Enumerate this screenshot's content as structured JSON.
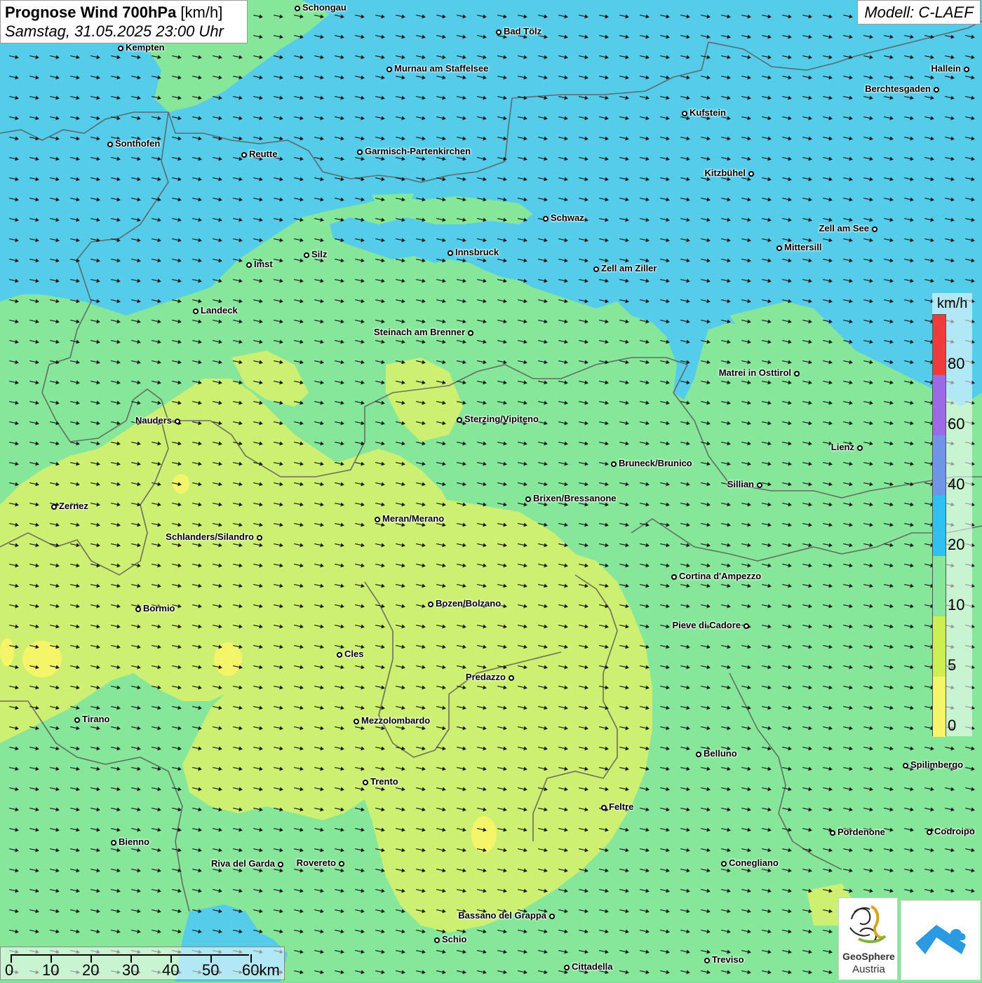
{
  "title": {
    "main": "Prognose Wind 700hPa",
    "unit": " [km/h]",
    "datetime": "Samstag, 31.05.2025 23:00 Uhr"
  },
  "model": "Modell: C-LAEF",
  "wind_direction": "from west-northwest",
  "colors": {
    "band_0": "#f5f56a",
    "band_5": "#cdef72",
    "band_10": "#86e69a",
    "band_20": "#55ccea",
    "band_40": "#6f95e6",
    "band_60": "#9b6ae6",
    "band_80": "#ee3b3b"
  },
  "legend": {
    "unit": "km/h",
    "ticks": [
      "80",
      "60",
      "40",
      "20",
      "10",
      "5",
      "0"
    ],
    "segment_colors": [
      "#ee3b3b",
      "#9b6ae6",
      "#6f95e6",
      "#2fc1f0",
      "#86e69a",
      "#cdef52",
      "#f5f56a"
    ]
  },
  "scale_bar": {
    "labels": [
      "0",
      "10",
      "20",
      "30",
      "40",
      "50",
      "60km"
    ]
  },
  "logos": {
    "geosphere_line1": "GeoSphere",
    "geosphere_line2": "Austria"
  },
  "cities": [
    {
      "name": "Schongau"
    },
    {
      "name": "Bad Tölz"
    },
    {
      "name": "Kempten"
    },
    {
      "name": "Murnau am Staffelsee"
    },
    {
      "name": "Hallein"
    },
    {
      "name": "Berchtesgaden"
    },
    {
      "name": "Kufstein"
    },
    {
      "name": "Sonthofen"
    },
    {
      "name": "Reutte"
    },
    {
      "name": "Garmisch-Partenkirchen"
    },
    {
      "name": "Kitzbühel"
    },
    {
      "name": "Schwaz"
    },
    {
      "name": "Zell am See"
    },
    {
      "name": "Innsbruck"
    },
    {
      "name": "Mittersill"
    },
    {
      "name": "Silz"
    },
    {
      "name": "Imst"
    },
    {
      "name": "Zell am Ziller"
    },
    {
      "name": "Landeck"
    },
    {
      "name": "Steinach am Brenner"
    },
    {
      "name": "Matrei in Osttirol"
    },
    {
      "name": "Nauders"
    },
    {
      "name": "Sterzing/Vipiteno"
    },
    {
      "name": "Lienz"
    },
    {
      "name": "Bruneck/Brunico"
    },
    {
      "name": "Sillian"
    },
    {
      "name": "Brixen/Bressanone"
    },
    {
      "name": "Zernez"
    },
    {
      "name": "Meran/Merano"
    },
    {
      "name": "Schlanders/Silandro"
    },
    {
      "name": "Cortina d'Ampezzo"
    },
    {
      "name": "Bozen/Bolzano"
    },
    {
      "name": "Bormio"
    },
    {
      "name": "Pieve di Cadore"
    },
    {
      "name": "Cles"
    },
    {
      "name": "Predazzo"
    },
    {
      "name": "Tirano"
    },
    {
      "name": "Mezzolombardo"
    },
    {
      "name": "Belluno"
    },
    {
      "name": "Spilimbergo"
    },
    {
      "name": "Trento"
    },
    {
      "name": "Feltre"
    },
    {
      "name": "Pordenone"
    },
    {
      "name": "Codroipo"
    },
    {
      "name": "Bienno"
    },
    {
      "name": "Riva del Garda"
    },
    {
      "name": "Rovereto"
    },
    {
      "name": "Conegliano"
    },
    {
      "name": "Bassano del Grappa"
    },
    {
      "name": "Schio"
    },
    {
      "name": "Treviso"
    },
    {
      "name": "Cittadella"
    }
  ]
}
